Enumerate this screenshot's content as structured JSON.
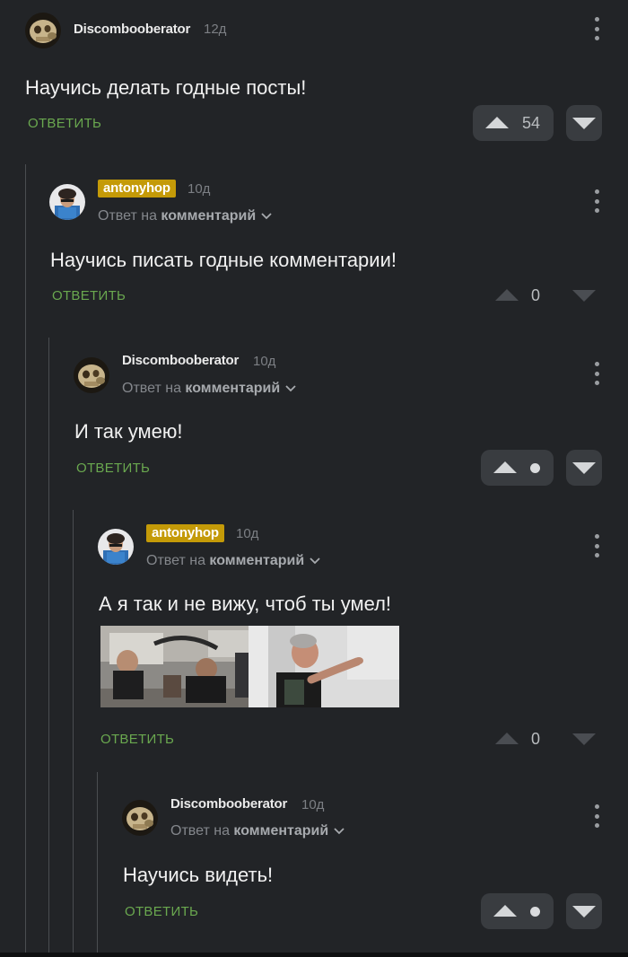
{
  "colors": {
    "background": "#222427",
    "reply_green": "#6aa84f",
    "badge_gold": "#c49a08",
    "vote_box": "#393c40"
  },
  "comments": [
    {
      "author": "Discombooberator",
      "time": "12д",
      "text": "Научись делать годные посты!",
      "reply": "ОТВЕТИТЬ",
      "rating": "54"
    },
    {
      "author": "antonyhop",
      "time": "10д",
      "reply_to_prefix": "Ответ на",
      "reply_to_target": "комментарий",
      "text": "Научись писать годные комментарии!",
      "reply": "ОТВЕТИТЬ",
      "rating": "0"
    },
    {
      "author": "Discombooberator",
      "time": "10д",
      "reply_to_prefix": "Ответ на",
      "reply_to_target": "комментарий",
      "text": "И так умею!",
      "reply": "ОТВЕТИТЬ"
    },
    {
      "author": "antonyhop",
      "time": "10д",
      "reply_to_prefix": "Ответ на",
      "reply_to_target": "комментарий",
      "text": "А я так и не вижу, чтоб ты умел!",
      "reply": "ОТВЕТИТЬ",
      "rating": "0"
    },
    {
      "author": "Discombooberator",
      "time": "10д",
      "reply_to_prefix": "Ответ на",
      "reply_to_target": "комментарий",
      "text": "Научись видеть!",
      "reply": "ОТВЕТИТЬ"
    }
  ]
}
